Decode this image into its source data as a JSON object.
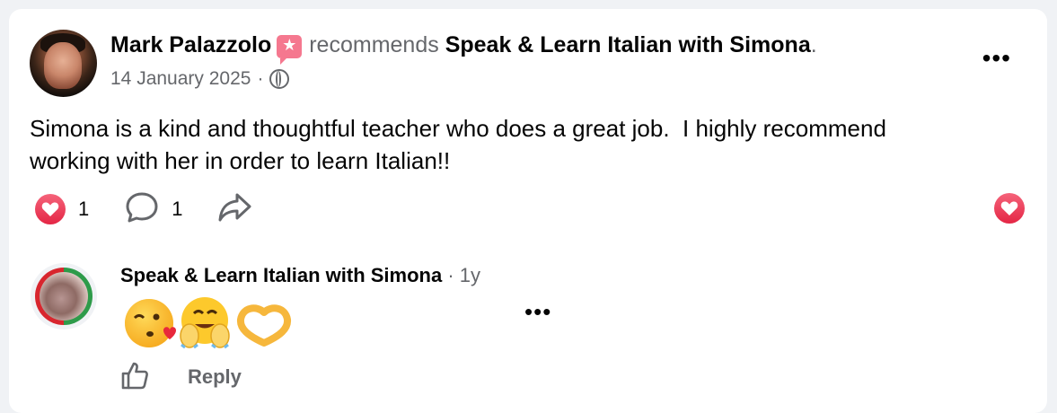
{
  "post": {
    "author": "Mark Palazzolo",
    "verb": "recommends",
    "page": "Speak & Learn Italian with Simona",
    "period": ".",
    "date": "14 January 2025",
    "separator": "·",
    "audience_icon": "globe-icon",
    "text": "Simona is a kind and thoughtful teacher who does a great job.  I highly recommend\nworking with her in order to learn Italian!!",
    "more_icon": "more-horizontal-icon",
    "recommend_badge_color": "#f5788f"
  },
  "actions": {
    "reaction_count": "1",
    "comment_count": "1",
    "reaction_icon": "heart-reaction-icon",
    "comment_icon": "comment-bubble-icon",
    "share_icon": "share-arrow-icon",
    "heart_color": "#e42645"
  },
  "comment": {
    "author": "Speak & Learn Italian with Simona",
    "separator": "·",
    "time": "1y",
    "emojis": [
      "face-blowing-kiss-emoji",
      "smiling-face-with-open-hands-emoji",
      "heart-hands-emoji"
    ],
    "more_icon": "more-horizontal-icon",
    "like_icon": "thumbs-up-icon",
    "reply_label": "Reply"
  }
}
